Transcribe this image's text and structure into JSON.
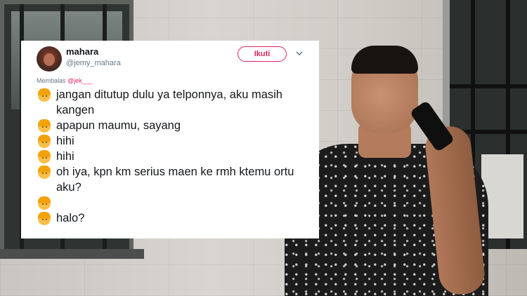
{
  "tweet": {
    "display_name": "mahara",
    "handle": "@jemy_mahara",
    "follow_label": "Ikuti",
    "reply_prefix": "Membalas",
    "reply_to": "@jek___",
    "lines": [
      "jangan ditutup dulu ya telponnya, aku masih kangen",
      "apapun maumu, sayang",
      "hihi",
      "hihi",
      "oh iya, kpn km serius maen ke rmh ktemu ortu aku?",
      "",
      "halo?"
    ]
  },
  "colors": {
    "accent": "#e0245e",
    "text": "#14171a",
    "muted": "#657786"
  },
  "icons": {
    "avatar": "profile-photo",
    "emoji": "person-emoji-blond",
    "caret": "chevron-down-icon"
  }
}
